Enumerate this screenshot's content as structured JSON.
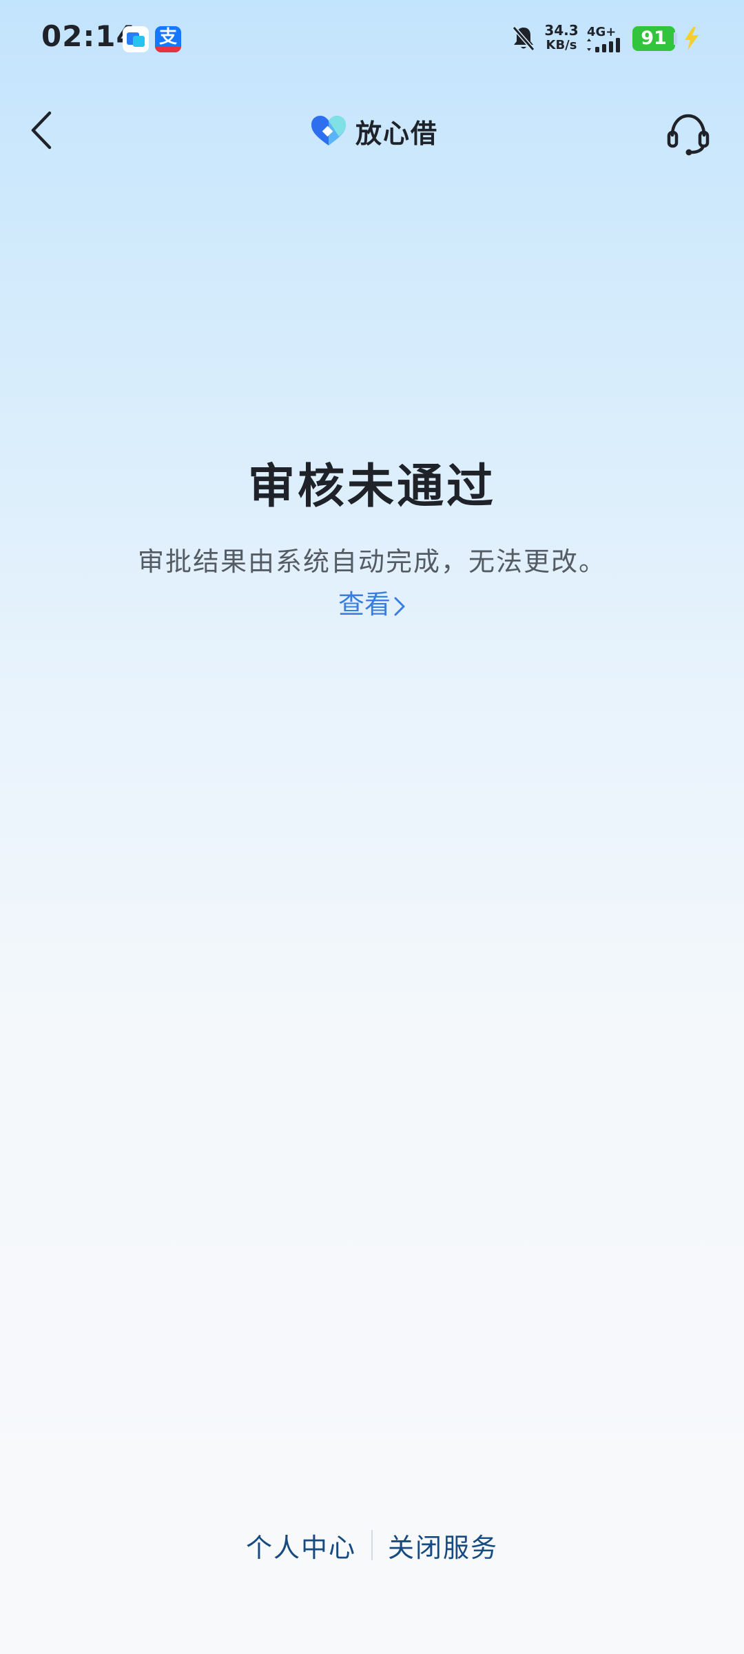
{
  "status_bar": {
    "time": "02:14",
    "net_speed_value": "34.3",
    "net_speed_unit": "KB/s",
    "network_type": "4G+",
    "battery_level": "91",
    "app_icon_2_glyph": "支"
  },
  "header": {
    "app_name": "放心借"
  },
  "result": {
    "title": "审核未通过",
    "description": "审批结果由系统自动完成，无法更改。",
    "view_label": "查看"
  },
  "footer": {
    "personal_center": "个人中心",
    "close_service": "关闭服务"
  },
  "colors": {
    "accent": "#3a7de0",
    "footer_link": "#174a80",
    "battery": "#32c43d"
  },
  "icons": [
    "bell-muted-icon",
    "signal-icon",
    "bolt-icon",
    "back-arrow-icon",
    "headset-icon",
    "logo-heart-icon",
    "chevron-right-icon"
  ]
}
